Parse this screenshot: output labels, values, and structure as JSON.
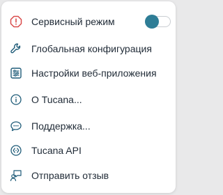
{
  "menu": {
    "items": [
      {
        "label": "Сервисный режим",
        "icon": "warning-icon"
      },
      {
        "label": "Глобальная конфигурация",
        "icon": "wrench-icon"
      },
      {
        "label": "Настройки веб-приложения",
        "icon": "sliders-icon"
      },
      {
        "label": "О Tucana...",
        "icon": "info-icon"
      },
      {
        "label": "Поддержка...",
        "icon": "chat-icon"
      },
      {
        "label": "Tucana API",
        "icon": "api-icon"
      },
      {
        "label": "Отправить отзыв",
        "icon": "feedback-icon"
      }
    ],
    "service_mode_toggle": {
      "on": false
    },
    "colors": {
      "warning": "#d94a4a",
      "icon": "#1e5b78",
      "toggle_knob": "#2e7d96",
      "text": "#1f2a36"
    }
  }
}
